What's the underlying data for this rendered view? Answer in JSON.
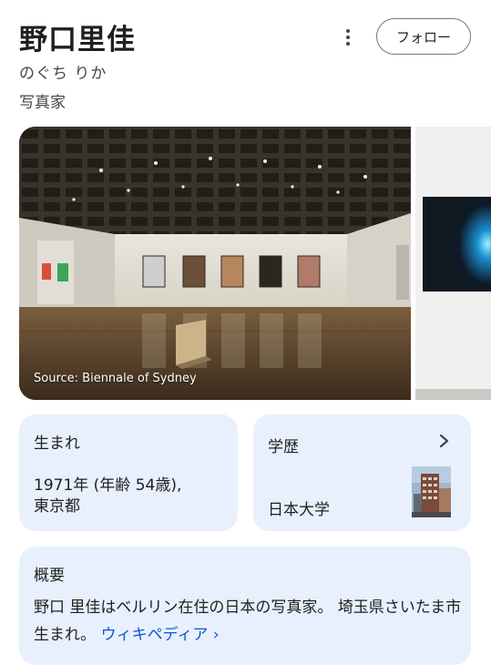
{
  "header": {
    "title": "野口里佳",
    "reading": "のぐち りか",
    "occupation": "写真家",
    "follow_label": "フォロー"
  },
  "gallery": {
    "source_caption": "Source: Biennale of Sydney"
  },
  "facts": {
    "born": {
      "title": "生まれ",
      "value": "1971年 (年齢 54歳),\n東京都"
    },
    "education": {
      "title": "学歴",
      "value": "日本大学"
    }
  },
  "about": {
    "title": "概要",
    "text": "野口 里佳はベルリン在住の日本の写真家。 埼玉県さいたま市生まれ。",
    "link_label": "ウィキペディア ›"
  },
  "icons": [
    "more-vert-icon",
    "chevron-right-icon"
  ]
}
